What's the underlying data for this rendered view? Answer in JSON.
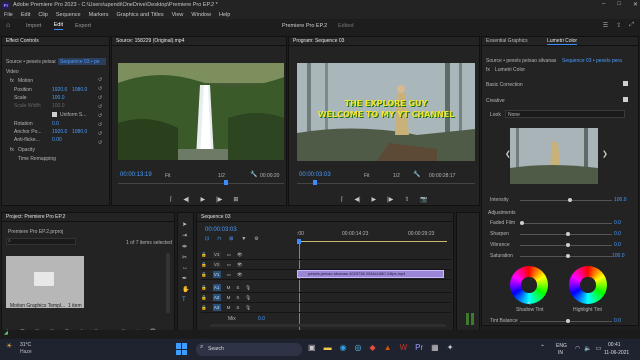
{
  "window": {
    "title": "Adobe Premiere Pro 2023 - C:\\Users\\upendi\\OneDrive\\Desktop\\Premiere Pro EP.2 *"
  },
  "menu": [
    "File",
    "Edit",
    "Clip",
    "Sequence",
    "Markers",
    "Graphics and Titles",
    "View",
    "Window",
    "Help"
  ],
  "workspace": {
    "tabs": [
      "Import",
      "Edit",
      "Export"
    ],
    "active": "Edit",
    "project_title": "Premiere Pro EP.2",
    "edited": "Edited"
  },
  "effect_controls": {
    "tab": "Effect Controls",
    "master_label": "Source • peseis peixao silvanas",
    "sequence_label": "Sequence 03 • pe",
    "video_header": "Video",
    "motion": "Motion",
    "rows": [
      {
        "label": "Position",
        "v1": "1920.0",
        "v2": "1080.0"
      },
      {
        "label": "Scale",
        "v1": "100.0",
        "v2": ""
      },
      {
        "label": "Scale Width",
        "v1": "100.0",
        "v2": ""
      },
      {
        "label": "Uniform S...",
        "v1": "",
        "v2": ""
      },
      {
        "label": "Rotation",
        "v1": "0.0",
        "v2": ""
      },
      {
        "label": "Anchor Po...",
        "v1": "1920.0",
        "v2": "1080.0"
      },
      {
        "label": "Anti-flicke...",
        "v1": "0.00",
        "v2": ""
      }
    ],
    "opacity": "Opacity",
    "time_remap": "Time Remapping"
  },
  "source_monitor": {
    "tab": "Source: 158229 (Original).mp4",
    "timecode": "00:00:13:19",
    "fit": "Fit",
    "fraction": "1/2",
    "duration": "00:00:20"
  },
  "program_monitor": {
    "tab": "Program: Sequence 03",
    "timecode": "00:00:03:03",
    "fit": "Fit",
    "fraction": "1/2",
    "duration": "00:00:28:17",
    "overlay_line1": "THE EXPLORE GUY",
    "overlay_line2": "WELCOME TO MY YT CHANNEL"
  },
  "project": {
    "tab": "Project: Premiere Pro EP.2",
    "file": "Premiere Pro EP.2.prproj",
    "count": "1 of 7 items selected",
    "item_name": "Motion Graphics Templ...",
    "item_count": "1 item"
  },
  "timeline": {
    "tab": "Sequence 03",
    "timecode": "00:00:03:03",
    "ruler": [
      "00:00:14:23",
      "00:00:29:23"
    ],
    "clip_label": "peseis peixao silvanas 4023738 2048x1080 24fps.mp4",
    "tracks_v": [
      "V3",
      "V2",
      "V1"
    ],
    "tracks_a": [
      "A1",
      "A2",
      "A3"
    ],
    "mix": "Mix",
    "mix_value": "0.0"
  },
  "lumetri": {
    "tabs": [
      "Essential Graphics",
      "Lumetri Color"
    ],
    "active": "Lumetri Color",
    "source": "Source • pexels peixao silvanas",
    "sequence": "Sequence 03 • pexels pera",
    "fx_label": "Lumetri Color",
    "basic": "Basic Correction",
    "creative": "Creative",
    "look_label": "Look",
    "look_value": "None",
    "intensity_label": "Intensity",
    "intensity": "100.0",
    "adjustments": "Adjustments",
    "sliders": [
      {
        "label": "Faded Film",
        "value": "0.0"
      },
      {
        "label": "Sharpen",
        "value": "0.0"
      },
      {
        "label": "Vibrance",
        "value": "0.0"
      },
      {
        "label": "Saturation",
        "value": "100.0"
      }
    ],
    "shadow_tint": "Shadow Tint",
    "highlight_tint": "Highlight Tint",
    "tint_balance_label": "Tint Balance",
    "tint_balance": "0.0"
  },
  "taskbar": {
    "weather_temp": "31°C",
    "weather_text": "Haze",
    "search": "Search",
    "lang": "ENG",
    "region": "IN",
    "time": "00:41",
    "date": "11-06-2021"
  },
  "colors": {
    "accent": "#3b8cff",
    "clip": "#9b86d6",
    "playhead": "#3b8cff"
  }
}
